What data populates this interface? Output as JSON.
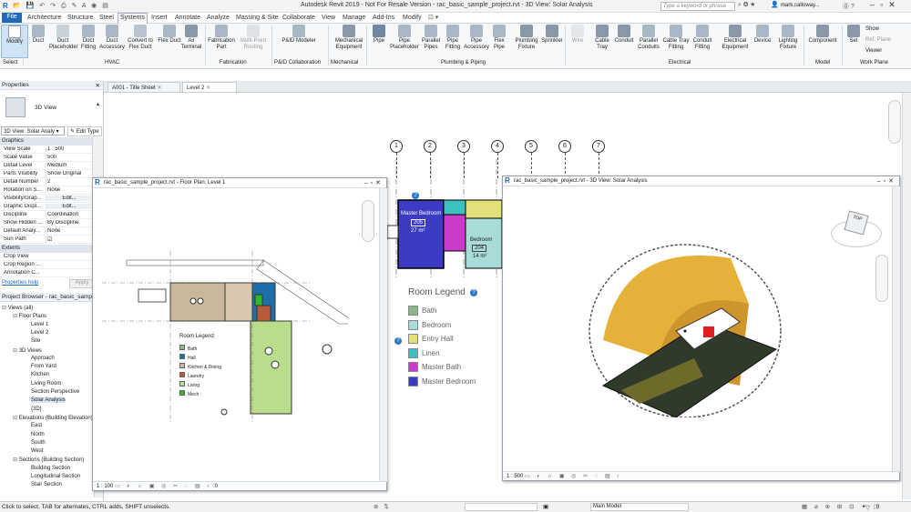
{
  "app": {
    "title": "Autodesk Revit 2019 - Not For Resale Version - rac_basic_sample_project.rvt - 3D View: Solar Analysis",
    "search_placeholder": "Type a keyword or phrase",
    "user": "mark.calloway..."
  },
  "menu": [
    "File",
    "Architecture",
    "Structure",
    "Steel",
    "Systems",
    "Insert",
    "Annotate",
    "Analyze",
    "Massing & Site",
    "Collaborate",
    "View",
    "Manage",
    "Add-Ins",
    "Modify"
  ],
  "ribbon": {
    "buttons": [
      {
        "label": "Modify",
        "icon": "cursor-icon"
      },
      {
        "label": "Duct",
        "icon": "duct-icon"
      },
      {
        "label": "Duct Placeholder",
        "icon": "duct-placeholder-icon"
      },
      {
        "label": "Duct Fitting",
        "icon": "duct-fitting-icon"
      },
      {
        "label": "Duct Accessory",
        "icon": "duct-accessory-icon"
      },
      {
        "label": "Convert to Flex Duct",
        "icon": "convert-flex-icon"
      },
      {
        "label": "Flex Duct",
        "icon": "flex-duct-icon"
      },
      {
        "label": "Air Terminal",
        "icon": "air-terminal-icon"
      },
      {
        "label": "Fabrication Part",
        "icon": "fabrication-part-icon"
      },
      {
        "label": "Multi-Point Routing",
        "icon": "routing-icon"
      },
      {
        "label": "P&ID Modeler",
        "icon": "pid-icon"
      },
      {
        "label": "Mechanical Equipment",
        "icon": "mech-equipment-icon"
      },
      {
        "label": "Pipe",
        "icon": "pipe-icon"
      },
      {
        "label": "Pipe Placeholder",
        "icon": "pipe-placeholder-icon"
      },
      {
        "label": "Parallel Pipes",
        "icon": "parallel-pipes-icon"
      },
      {
        "label": "Pipe Fitting",
        "icon": "pipe-fitting-icon"
      },
      {
        "label": "Pipe Accessory",
        "icon": "pipe-accessory-icon"
      },
      {
        "label": "Flex Pipe",
        "icon": "flex-pipe-icon"
      },
      {
        "label": "Plumbing Fixture",
        "icon": "plumbing-fixture-icon"
      },
      {
        "label": "Sprinkler",
        "icon": "sprinkler-icon"
      },
      {
        "label": "Wire",
        "icon": "wire-icon"
      },
      {
        "label": "Cable Tray",
        "icon": "cable-tray-icon"
      },
      {
        "label": "Conduit",
        "icon": "conduit-icon"
      },
      {
        "label": "Parallel Conduits",
        "icon": "parallel-conduits-icon"
      },
      {
        "label": "Cable Tray Fitting",
        "icon": "cable-tray-fitting-icon"
      },
      {
        "label": "Conduit Fitting",
        "icon": "conduit-fitting-icon"
      },
      {
        "label": "Electrical Equipment",
        "icon": "electrical-equipment-icon"
      },
      {
        "label": "Device",
        "icon": "device-icon"
      },
      {
        "label": "Lighting Fixture",
        "icon": "lighting-fixture-icon"
      },
      {
        "label": "Component",
        "icon": "component-icon"
      },
      {
        "label": "Set",
        "icon": "set-icon"
      }
    ],
    "groups": [
      "Select",
      "HVAC",
      "Fabrication",
      "P&ID Collaboration",
      "Mechanical",
      "Plumbing & Piping",
      "Electrical",
      "Model",
      "Work Plane"
    ],
    "workplane": {
      "show": "Show",
      "ref_plane": "Ref. Plane",
      "viewer": "Viewer"
    }
  },
  "properties": {
    "header": "Properties",
    "type": "3D View",
    "selector": "3D View: Solar Analy",
    "edit_type": "Edit Type",
    "section_graphics": "Graphics",
    "rows": [
      {
        "k": "View Scale",
        "v": "1 : 500"
      },
      {
        "k": "Scale Value",
        "v": "500"
      },
      {
        "k": "Detail Level",
        "v": "Medium"
      },
      {
        "k": "Parts Visibility",
        "v": "Show Original"
      },
      {
        "k": "Detail Number",
        "v": "2"
      },
      {
        "k": "Rotation on S...",
        "v": "None"
      },
      {
        "k": "Visibility/Grap...",
        "v": "Edit..."
      },
      {
        "k": "Graphic Displ...",
        "v": "Edit..."
      },
      {
        "k": "Discipline",
        "v": "Coordination"
      },
      {
        "k": "Show Hidden ...",
        "v": "By Discipline"
      },
      {
        "k": "Default Analy...",
        "v": "None"
      },
      {
        "k": "Sun Path",
        "v": "☑"
      }
    ],
    "section_extents": "Extents",
    "rows2": [
      {
        "k": "Crop View",
        "v": ""
      },
      {
        "k": "Crop Region ...",
        "v": ""
      },
      {
        "k": "Annotation C...",
        "v": ""
      }
    ],
    "help": "Properties help",
    "apply": "Apply"
  },
  "browser": {
    "header": "Project Browser - rac_basic_sample...",
    "items": [
      {
        "t": "Views (all)",
        "lvl": 0
      },
      {
        "t": "Floor Plans",
        "lvl": 1
      },
      {
        "t": "Level 1",
        "lvl": 2
      },
      {
        "t": "Level 2",
        "lvl": 2
      },
      {
        "t": "Site",
        "lvl": 2
      },
      {
        "t": "3D Views",
        "lvl": 1
      },
      {
        "t": "Approach",
        "lvl": 2
      },
      {
        "t": "From Yard",
        "lvl": 2
      },
      {
        "t": "Kitchen",
        "lvl": 2
      },
      {
        "t": "Living Room",
        "lvl": 2
      },
      {
        "t": "Section Perspective",
        "lvl": 2
      },
      {
        "t": "Solar Analysis",
        "lvl": 2
      },
      {
        "t": "{3D}",
        "lvl": 2
      },
      {
        "t": "Elevations (Building Elevation)",
        "lvl": 1
      },
      {
        "t": "East",
        "lvl": 2
      },
      {
        "t": "North",
        "lvl": 2
      },
      {
        "t": "South",
        "lvl": 2
      },
      {
        "t": "West",
        "lvl": 2
      },
      {
        "t": "Sections (Building Section)",
        "lvl": 1
      },
      {
        "t": "Building Section",
        "lvl": 2
      },
      {
        "t": "Longitudinal Section",
        "lvl": 2
      },
      {
        "t": "Stair Section",
        "lvl": 2
      }
    ]
  },
  "view_tabs": [
    "A001 - Title Sheet",
    "Level 2"
  ],
  "floor_window": {
    "title": "rac_basic_sample_project.rvt - Floor Plan: Level 1",
    "scale": "1 : 100",
    "legend_title": "Room Legend",
    "legend": [
      "Bath",
      "Hall",
      "Kitchen & Dining",
      "Laundry",
      "Living",
      "Mech"
    ]
  },
  "solar_window": {
    "title": "rac_basic_sample_project.rvt - 3D View: Solar Analysis",
    "scale": "1 : 500",
    "cube": "TOP"
  },
  "background_plan": {
    "grids": [
      "1",
      "2",
      "3",
      "4",
      "5",
      "6",
      "7"
    ],
    "legend_title": "Room Legend",
    "legend": [
      {
        "name": "Bath",
        "color": "#8fb58a"
      },
      {
        "name": "Bedroom",
        "color": "#a8dcd8"
      },
      {
        "name": "Entry Hall",
        "color": "#e3e07a"
      },
      {
        "name": "Linen",
        "color": "#3fc0c0"
      },
      {
        "name": "Master Bath",
        "color": "#c93cc9"
      },
      {
        "name": "Master Bedroom",
        "color": "#3b3bc4"
      }
    ],
    "rooms": [
      {
        "name": "Master Bedroom",
        "num": "205",
        "area": "27 m²"
      },
      {
        "name": "Bedroom",
        "num": "204",
        "area": "14 m²"
      }
    ]
  },
  "status": {
    "hint": "Click to select, TAB for alternates, CTRL adds, SHIFT unselects.",
    "model": "Main Model",
    "zero": ":0"
  }
}
